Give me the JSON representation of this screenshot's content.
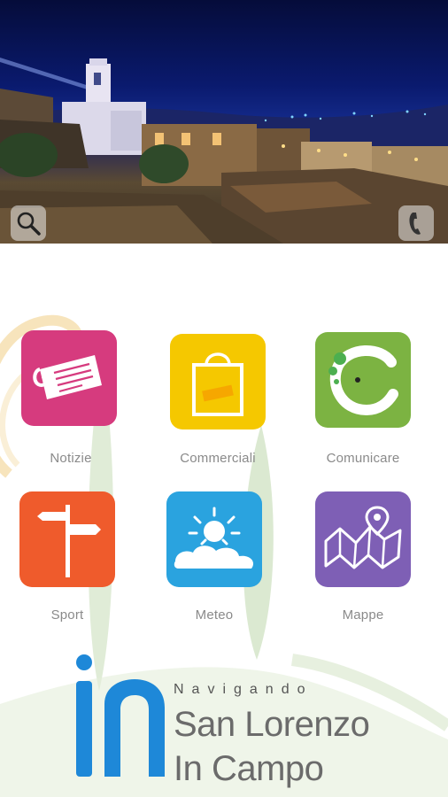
{
  "header": {
    "search_icon": "search-icon",
    "phone_icon": "phone-icon"
  },
  "menu": {
    "items": [
      {
        "label": "Notizie",
        "icon": "newspaper-icon",
        "color": "#d63b7e"
      },
      {
        "label": "Commerciali",
        "icon": "shopping-bag-icon",
        "color": "#f5c800"
      },
      {
        "label": "Comunicare",
        "icon": "comunicare-logo-icon",
        "color": "#7cb342"
      },
      {
        "label": "Sport",
        "icon": "signpost-icon",
        "color": "#ef5b2c"
      },
      {
        "label": "Meteo",
        "icon": "sun-cloud-icon",
        "color": "#2aa3df"
      },
      {
        "label": "Mappe",
        "icon": "map-pin-icon",
        "color": "#7e5fb5"
      }
    ]
  },
  "logo": {
    "prefix": "in",
    "tagline": "Navigando",
    "line1": "San Lorenzo",
    "line2": "In Campo",
    "accent_color": "#1e88d8"
  }
}
